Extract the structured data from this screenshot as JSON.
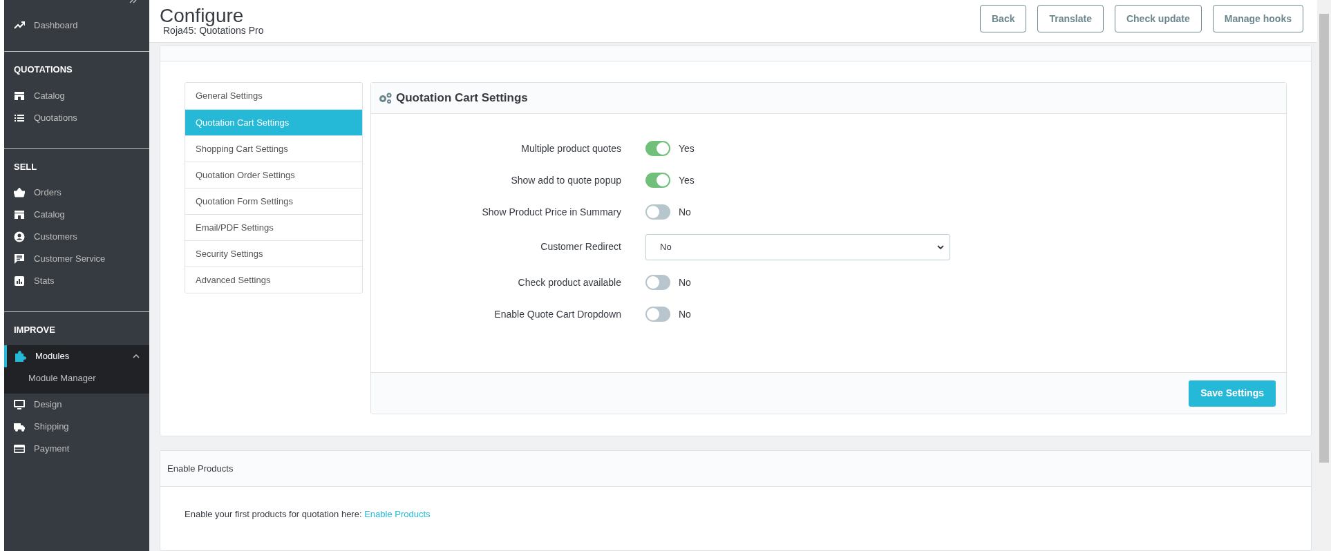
{
  "sidebar": {
    "top_items": [
      {
        "label": "Dashboard",
        "kind": "trend"
      }
    ],
    "sections": [
      {
        "title": "QUOTATIONS",
        "items": [
          {
            "label": "Catalog",
            "kind": "store",
            "selected": false,
            "expanded": false
          },
          {
            "label": "Quotations",
            "kind": "list",
            "selected": false,
            "expanded": false
          }
        ]
      },
      {
        "title": "SELL",
        "items": [
          {
            "label": "Orders",
            "kind": "basket",
            "selected": false,
            "expanded": false
          },
          {
            "label": "Catalog",
            "kind": "store",
            "selected": false,
            "expanded": false
          },
          {
            "label": "Customers",
            "kind": "user",
            "selected": false,
            "expanded": false
          },
          {
            "label": "Customer Service",
            "kind": "chat",
            "selected": false,
            "expanded": false
          },
          {
            "label": "Stats",
            "kind": "stats",
            "selected": false,
            "expanded": false
          }
        ]
      },
      {
        "title": "IMPROVE",
        "items": [
          {
            "label": "Modules",
            "kind": "puzzle",
            "selected": true,
            "expanded": true,
            "children": [
              {
                "label": "Module Manager"
              }
            ]
          },
          {
            "label": "Design",
            "kind": "monitor",
            "selected": false,
            "expanded": false
          },
          {
            "label": "Shipping",
            "kind": "truck",
            "selected": false,
            "expanded": false
          },
          {
            "label": "Payment",
            "kind": "card",
            "selected": false,
            "expanded": false
          }
        ]
      }
    ]
  },
  "header": {
    "title": "Configure",
    "subtitle": "Roja45: Quotations Pro",
    "buttons": [
      "Back",
      "Translate",
      "Check update",
      "Manage hooks"
    ]
  },
  "tabs": [
    {
      "label": "General Settings",
      "selected": false
    },
    {
      "label": "Quotation Cart Settings",
      "selected": true
    },
    {
      "label": "Shopping Cart Settings",
      "selected": false
    },
    {
      "label": "Quotation Order Settings",
      "selected": false
    },
    {
      "label": "Quotation Form Settings",
      "selected": false
    },
    {
      "label": "Email/PDF Settings",
      "selected": false
    },
    {
      "label": "Security Settings",
      "selected": false
    },
    {
      "label": "Advanced Settings",
      "selected": false
    }
  ],
  "settings_panel": {
    "title": "Quotation Cart Settings",
    "fields": [
      {
        "kind": "switch",
        "label": "Multiple product quotes",
        "on": true,
        "value": "Yes"
      },
      {
        "kind": "switch",
        "label": "Show add to quote popup",
        "on": true,
        "value": "Yes"
      },
      {
        "kind": "switch",
        "label": "Show Product Price in Summary",
        "on": false,
        "value": "No"
      },
      {
        "kind": "select",
        "label": "Customer Redirect",
        "value": "No"
      },
      {
        "kind": "switch",
        "label": "Check product available",
        "on": false,
        "value": "No"
      },
      {
        "kind": "switch",
        "label": "Enable Quote Cart Dropdown",
        "on": false,
        "value": "No"
      }
    ],
    "save_button": "Save Settings"
  },
  "enable_products": {
    "title": "Enable Products",
    "text": "Enable your first products for quotation here:",
    "link": "Enable Products"
  }
}
